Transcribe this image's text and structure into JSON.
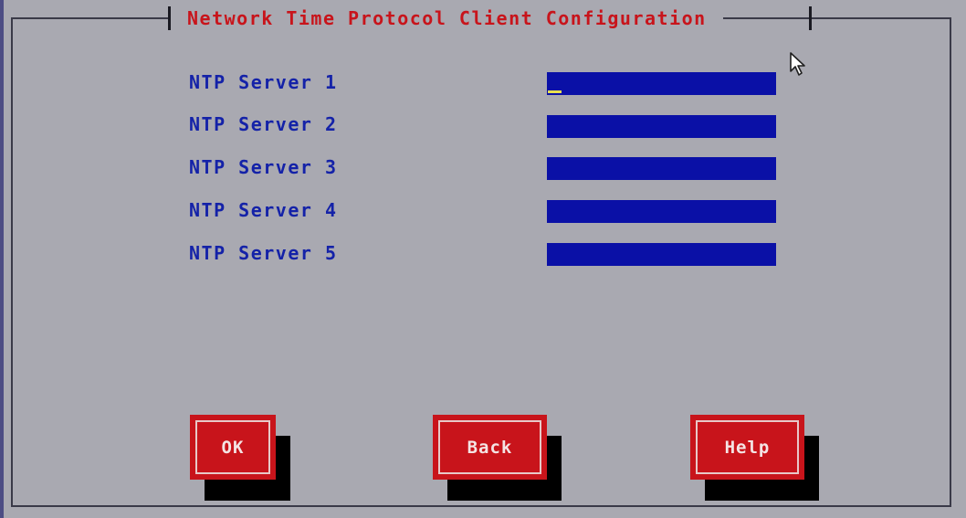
{
  "dialog": {
    "title": "Network Time Protocol Client Configuration"
  },
  "fields": [
    {
      "label": "NTP Server 1",
      "value": ""
    },
    {
      "label": "NTP Server 2",
      "value": ""
    },
    {
      "label": "NTP Server 3",
      "value": ""
    },
    {
      "label": "NTP Server 4",
      "value": ""
    },
    {
      "label": "NTP Server 5",
      "value": ""
    }
  ],
  "buttons": {
    "ok": "OK",
    "back": "Back",
    "help": "Help"
  },
  "colors": {
    "background": "#a9a9b1",
    "title": "#c8141b",
    "label": "#1422a8",
    "field": "#0a10a6",
    "button": "#c8141b",
    "cursor": "#e8e050"
  },
  "icons": {
    "mouse_pointer": "arrow-cursor-icon"
  }
}
